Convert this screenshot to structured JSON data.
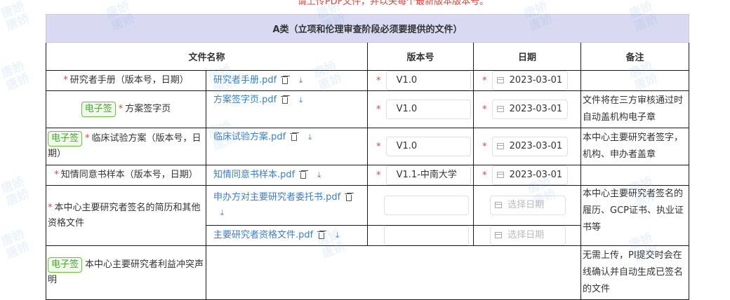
{
  "top_note": "请上传PDF文件，并以关每个最新版本版本号。",
  "watermark_text": "唐娇\n唐娇",
  "section_title": "A类（立项和伦理审查阶段必须要提供的文件）",
  "headers": {
    "name": "文件名称",
    "version": "版本号",
    "date": "日期",
    "note": "备注"
  },
  "badge_label": "电子签",
  "date_placeholder": "选择日期",
  "rows": [
    {
      "name": "研究者手册（版本号，日期）",
      "file": "研究者手册.pdf",
      "version": "V1.0",
      "date": "2023-03-01",
      "note": ""
    },
    {
      "name": "方案签字页",
      "file": "方案签字页.pdf",
      "version": "V1.0",
      "date": "2023-03-01",
      "note": "文件将在三方审核通过时自动盖机构电子章"
    },
    {
      "name": "临床试验方案（版本号，日期）",
      "file": "临床试验方案.pdf",
      "version": "V1.0",
      "date": "2023-03-01",
      "note": "本中心主要研究者签字，机构、申办者盖章"
    },
    {
      "name": "知情同意书样本（版本号，日期）",
      "file": "知情同意书样本.pdf",
      "version": "V1.1-中南大学",
      "date": "2023-03-01",
      "note": ""
    },
    {
      "name": "本中心主要研究者签名的简历和其他资格文件",
      "files": [
        "申办方对主要研究者委托书.pdf",
        "主要研究者资格文件.pdf"
      ],
      "note": "本中心主要研究者签名的履历、GCP证书、执业证书等"
    },
    {
      "name": "本中心主要研究者利益冲突声明",
      "note": "无需上传，PI提交时会在线确认并自动生成已签名的文件"
    }
  ]
}
